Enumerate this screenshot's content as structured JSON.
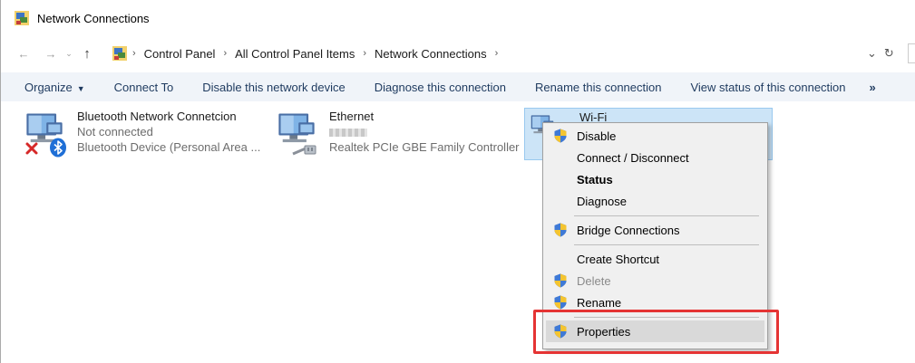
{
  "window": {
    "title": "Network Connections",
    "icon": "network-connections-icon"
  },
  "navigation": {
    "back": "←",
    "forward": "→",
    "recent": "⌄",
    "up": "↑",
    "breadcrumbs": [
      "Control Panel",
      "All Control Panel Items",
      "Network Connections"
    ],
    "separator": "›",
    "dropdown": "⌄",
    "refresh": "↻"
  },
  "commandbar": {
    "organize": "Organize",
    "items": [
      "Connect To",
      "Disable this network device",
      "Diagnose this connection",
      "Rename this connection",
      "View status of this connection"
    ],
    "more": "»"
  },
  "connections": [
    {
      "name": "Bluetooth Network Connetcion",
      "status": "Not connected",
      "device": "Bluetooth Device (Personal Area ..."
    },
    {
      "name": "Ethernet",
      "status": "",
      "device": "Realtek PCIe GBE Family Controller"
    },
    {
      "name": "Wi-Fi"
    }
  ],
  "context_menu": {
    "disable": "Disable",
    "connect_disconnect": "Connect / Disconnect",
    "status": "Status",
    "diagnose": "Diagnose",
    "bridge": "Bridge Connections",
    "create_shortcut": "Create Shortcut",
    "delete": "Delete",
    "rename": "Rename",
    "properties": "Properties"
  },
  "colors": {
    "accent": "#cce4f7",
    "highlight_border": "#e53434",
    "commandbar": "#f0f4f9"
  }
}
